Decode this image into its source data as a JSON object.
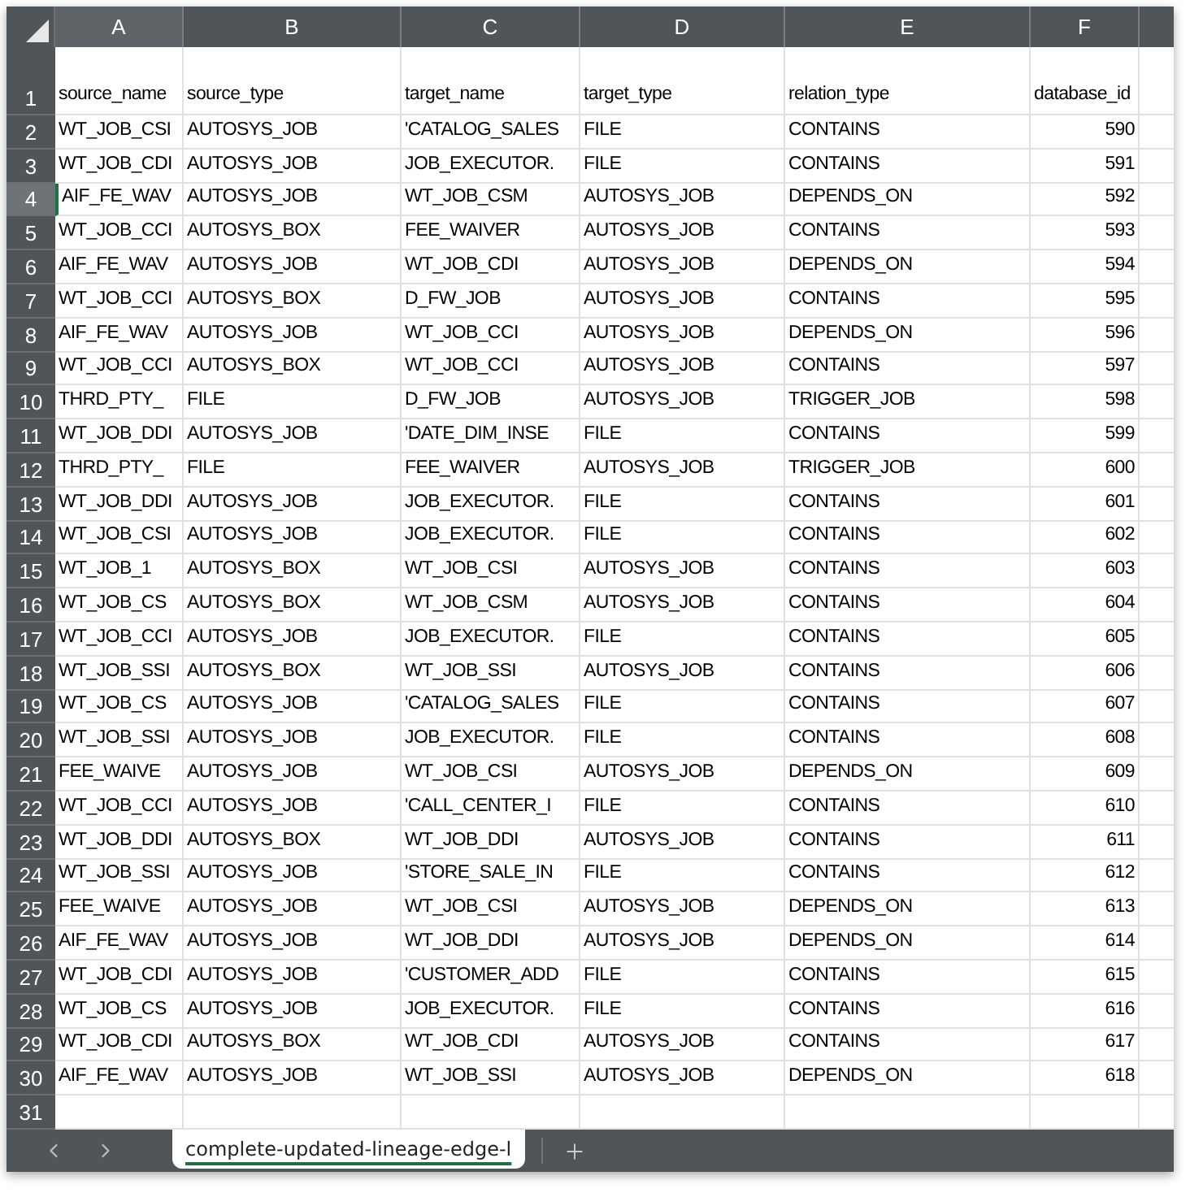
{
  "columns": [
    {
      "letter": "A",
      "selected": true
    },
    {
      "letter": "B",
      "selected": false
    },
    {
      "letter": "C",
      "selected": false
    },
    {
      "letter": "D",
      "selected": false
    },
    {
      "letter": "E",
      "selected": false
    },
    {
      "letter": "F",
      "selected": false
    }
  ],
  "header_row": {
    "number": "1",
    "selected": false,
    "cells": [
      "source_name",
      "source_type",
      "target_name",
      "target_type",
      "relation_type",
      "database_id"
    ]
  },
  "rows": [
    {
      "number": "2",
      "selected": false,
      "cells": [
        "WT_JOB_CSI",
        "AUTOSYS_JOB",
        "'CATALOG_SALES",
        "FILE",
        "CONTAINS",
        "590"
      ]
    },
    {
      "number": "3",
      "selected": false,
      "cells": [
        "WT_JOB_CDI",
        "AUTOSYS_JOB",
        "JOB_EXECUTOR.",
        "FILE",
        "CONTAINS",
        "591"
      ]
    },
    {
      "number": "4",
      "selected": true,
      "cells": [
        "AIF_FE_WAV",
        "AUTOSYS_JOB",
        "WT_JOB_CSM",
        "AUTOSYS_JOB",
        "DEPENDS_ON",
        "592"
      ]
    },
    {
      "number": "5",
      "selected": false,
      "cells": [
        "WT_JOB_CCI",
        "AUTOSYS_BOX",
        "FEE_WAIVER",
        "AUTOSYS_JOB",
        "CONTAINS",
        "593"
      ]
    },
    {
      "number": "6",
      "selected": false,
      "cells": [
        "AIF_FE_WAV",
        "AUTOSYS_JOB",
        "WT_JOB_CDI",
        "AUTOSYS_JOB",
        "DEPENDS_ON",
        "594"
      ]
    },
    {
      "number": "7",
      "selected": false,
      "cells": [
        "WT_JOB_CCI",
        "AUTOSYS_BOX",
        "D_FW_JOB",
        "AUTOSYS_JOB",
        "CONTAINS",
        "595"
      ]
    },
    {
      "number": "8",
      "selected": false,
      "cells": [
        "AIF_FE_WAV",
        "AUTOSYS_JOB",
        "WT_JOB_CCI",
        "AUTOSYS_JOB",
        "DEPENDS_ON",
        "596"
      ]
    },
    {
      "number": "9",
      "selected": false,
      "cells": [
        "WT_JOB_CCI",
        "AUTOSYS_BOX",
        "WT_JOB_CCI",
        "AUTOSYS_JOB",
        "CONTAINS",
        "597"
      ]
    },
    {
      "number": "10",
      "selected": false,
      "cells": [
        "THRD_PTY_",
        "FILE",
        "D_FW_JOB",
        "AUTOSYS_JOB",
        "TRIGGER_JOB",
        "598"
      ]
    },
    {
      "number": "11",
      "selected": false,
      "cells": [
        "WT_JOB_DDI",
        "AUTOSYS_JOB",
        "'DATE_DIM_INSE",
        "FILE",
        "CONTAINS",
        "599"
      ]
    },
    {
      "number": "12",
      "selected": false,
      "cells": [
        "THRD_PTY_",
        "FILE",
        "FEE_WAIVER",
        "AUTOSYS_JOB",
        "TRIGGER_JOB",
        "600"
      ]
    },
    {
      "number": "13",
      "selected": false,
      "cells": [
        "WT_JOB_DDI",
        "AUTOSYS_JOB",
        "JOB_EXECUTOR.",
        "FILE",
        "CONTAINS",
        "601"
      ]
    },
    {
      "number": "14",
      "selected": false,
      "cells": [
        "WT_JOB_CSI",
        "AUTOSYS_JOB",
        "JOB_EXECUTOR.",
        "FILE",
        "CONTAINS",
        "602"
      ]
    },
    {
      "number": "15",
      "selected": false,
      "cells": [
        "WT_JOB_1",
        "AUTOSYS_BOX",
        "WT_JOB_CSI",
        "AUTOSYS_JOB",
        "CONTAINS",
        "603"
      ]
    },
    {
      "number": "16",
      "selected": false,
      "cells": [
        "WT_JOB_CS",
        "AUTOSYS_BOX",
        "WT_JOB_CSM",
        "AUTOSYS_JOB",
        "CONTAINS",
        "604"
      ]
    },
    {
      "number": "17",
      "selected": false,
      "cells": [
        "WT_JOB_CCI",
        "AUTOSYS_JOB",
        "JOB_EXECUTOR.",
        "FILE",
        "CONTAINS",
        "605"
      ]
    },
    {
      "number": "18",
      "selected": false,
      "cells": [
        "WT_JOB_SSI",
        "AUTOSYS_BOX",
        "WT_JOB_SSI",
        "AUTOSYS_JOB",
        "CONTAINS",
        "606"
      ]
    },
    {
      "number": "19",
      "selected": false,
      "cells": [
        "WT_JOB_CS",
        "AUTOSYS_JOB",
        "'CATALOG_SALES",
        "FILE",
        "CONTAINS",
        "607"
      ]
    },
    {
      "number": "20",
      "selected": false,
      "cells": [
        "WT_JOB_SSI",
        "AUTOSYS_JOB",
        "JOB_EXECUTOR.",
        "FILE",
        "CONTAINS",
        "608"
      ]
    },
    {
      "number": "21",
      "selected": false,
      "cells": [
        "FEE_WAIVE",
        "AUTOSYS_JOB",
        "WT_JOB_CSI",
        "AUTOSYS_JOB",
        "DEPENDS_ON",
        "609"
      ]
    },
    {
      "number": "22",
      "selected": false,
      "cells": [
        "WT_JOB_CCI",
        "AUTOSYS_JOB",
        "'CALL_CENTER_I",
        "FILE",
        "CONTAINS",
        "610"
      ]
    },
    {
      "number": "23",
      "selected": false,
      "cells": [
        "WT_JOB_DDI",
        "AUTOSYS_BOX",
        "WT_JOB_DDI",
        "AUTOSYS_JOB",
        "CONTAINS",
        "611"
      ]
    },
    {
      "number": "24",
      "selected": false,
      "cells": [
        "WT_JOB_SSI",
        "AUTOSYS_JOB",
        "'STORE_SALE_IN",
        "FILE",
        "CONTAINS",
        "612"
      ]
    },
    {
      "number": "25",
      "selected": false,
      "cells": [
        "FEE_WAIVE",
        "AUTOSYS_JOB",
        "WT_JOB_CSI",
        "AUTOSYS_JOB",
        "DEPENDS_ON",
        "613"
      ]
    },
    {
      "number": "26",
      "selected": false,
      "cells": [
        "AIF_FE_WAV",
        "AUTOSYS_JOB",
        "WT_JOB_DDI",
        "AUTOSYS_JOB",
        "DEPENDS_ON",
        "614"
      ]
    },
    {
      "number": "27",
      "selected": false,
      "cells": [
        "WT_JOB_CDI",
        "AUTOSYS_JOB",
        "'CUSTOMER_ADD",
        "FILE",
        "CONTAINS",
        "615"
      ]
    },
    {
      "number": "28",
      "selected": false,
      "cells": [
        "WT_JOB_CS",
        "AUTOSYS_JOB",
        "JOB_EXECUTOR.",
        "FILE",
        "CONTAINS",
        "616"
      ]
    },
    {
      "number": "29",
      "selected": false,
      "cells": [
        "WT_JOB_CDI",
        "AUTOSYS_BOX",
        "WT_JOB_CDI",
        "AUTOSYS_JOB",
        "CONTAINS",
        "617"
      ]
    },
    {
      "number": "30",
      "selected": false,
      "cells": [
        "AIF_FE_WAV",
        "AUTOSYS_JOB",
        "WT_JOB_SSI",
        "AUTOSYS_JOB",
        "DEPENDS_ON",
        "618"
      ]
    }
  ],
  "blank_rows": [
    {
      "number": "31",
      "selected": false
    }
  ],
  "sheet_tabs": [
    {
      "label": "complete-updated-lineage-edge-l",
      "selected": true
    }
  ]
}
